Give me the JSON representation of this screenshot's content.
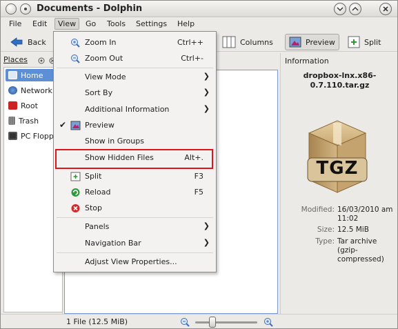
{
  "window": {
    "title": "Documents - Dolphin"
  },
  "menubar": {
    "items": [
      "File",
      "Edit",
      "View",
      "Go",
      "Tools",
      "Settings",
      "Help"
    ]
  },
  "toolbar": {
    "back_label": "Back",
    "columns_label": "Columns",
    "preview_label": "Preview",
    "split_label": "Split"
  },
  "places": {
    "title": "Places",
    "items": [
      {
        "label": "Home",
        "icon": "home-folder-icon",
        "color": "#5b8fd2",
        "selected": true
      },
      {
        "label": "Network",
        "icon": "network-globe-icon",
        "color": "#3b6fb8",
        "selected": false
      },
      {
        "label": "Root",
        "icon": "root-folder-icon",
        "color": "#cc2222",
        "selected": false
      },
      {
        "label": "Trash",
        "icon": "trash-icon",
        "color": "#777777",
        "selected": false
      },
      {
        "label": "PC Flopp",
        "icon": "floppy-icon",
        "color": "#333333",
        "selected": false
      }
    ]
  },
  "view_menu": {
    "items": [
      {
        "label": "Zoom In",
        "shortcut": "Ctrl++",
        "icon": "zoom-in-icon"
      },
      {
        "label": "Zoom Out",
        "shortcut": "Ctrl+-",
        "icon": "zoom-out-icon"
      },
      {
        "label": "View Mode",
        "submenu": true
      },
      {
        "label": "Sort By",
        "submenu": true
      },
      {
        "label": "Additional Information",
        "submenu": true
      },
      {
        "label": "Preview",
        "checked": true,
        "icon": "preview-icon"
      },
      {
        "label": "Show in Groups"
      },
      {
        "label": "Show Hidden Files",
        "shortcut": "Alt+.",
        "highlighted": true
      },
      {
        "label": "Split",
        "shortcut": "F3",
        "icon": "split-icon"
      },
      {
        "label": "Reload",
        "shortcut": "F5",
        "icon": "reload-icon"
      },
      {
        "label": "Stop",
        "icon": "stop-icon"
      },
      {
        "label": "Panels",
        "submenu": true
      },
      {
        "label": "Navigation Bar",
        "submenu": true
      },
      {
        "label": "Adjust View Properties..."
      }
    ]
  },
  "information": {
    "title": "Information",
    "file_name": "dropbox-lnx.x86-0.7.110.tar.gz",
    "icon_text": "TGZ",
    "modified_label": "Modified:",
    "modified_value": "16/03/2010 am 11:02",
    "size_label": "Size:",
    "size_value": "12.5 MiB",
    "type_label": "Type:",
    "type_value": "Tar archive (gzip-compressed)"
  },
  "status": {
    "text": "1 File (12.5 MiB)"
  },
  "colors": {
    "highlight": "#e0121a",
    "selection": "#5c8fd6",
    "accent": "#3b6fb8"
  }
}
